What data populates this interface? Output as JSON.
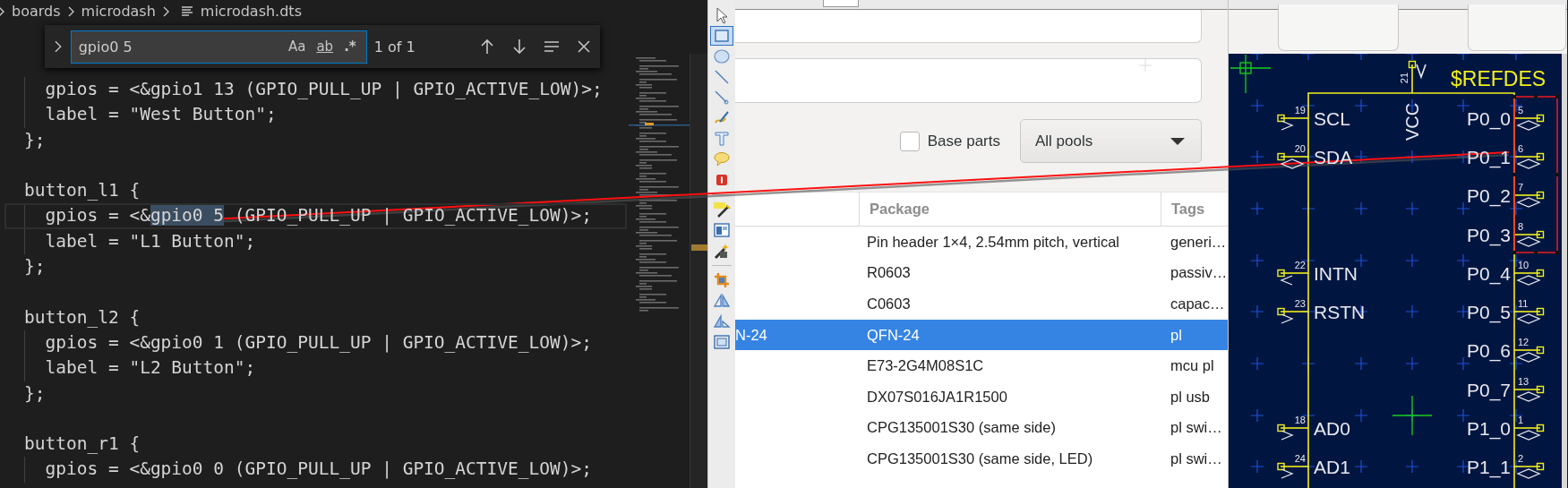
{
  "editor": {
    "breadcrumb": [
      "boards",
      "microdash",
      "microdash.dts"
    ],
    "find": {
      "query": "gpio0 5",
      "options": [
        "Aa",
        "ab",
        ".*"
      ],
      "match_count": "1 of 1"
    },
    "blocks": [
      {
        "lines": [
          {
            "text": "  gpios = <&gpio1 13 (GPIO_PULL_UP | GPIO_ACTIVE_LOW)>;",
            "indented": true,
            "current": false
          },
          {
            "text": "  label = \"West Button\";",
            "indented": true,
            "current": false
          },
          {
            "text": "};",
            "indented": false,
            "current": false
          }
        ]
      },
      {
        "lines": [
          {
            "text": "button_l1 {",
            "indented": false,
            "current": false
          },
          {
            "text": "  gpios = <&",
            "match": "gpio0 5",
            "text_after": " (GPIO_PULL_UP | GPIO_ACTIVE_LOW)>;",
            "indented": true,
            "current": true
          },
          {
            "text": "  label = \"L1 Button\";",
            "indented": true,
            "current": false
          },
          {
            "text": "};",
            "indented": false,
            "current": false
          }
        ]
      },
      {
        "lines": [
          {
            "text": "button_l2 {",
            "indented": false,
            "current": false
          },
          {
            "text": "  gpios = <&gpio0 1 (GPIO_PULL_UP | GPIO_ACTIVE_LOW)>;",
            "indented": true,
            "current": false
          },
          {
            "text": "  label = \"L2 Button\";",
            "indented": true,
            "current": false
          },
          {
            "text": "};",
            "indented": false,
            "current": false
          }
        ]
      },
      {
        "lines": [
          {
            "text": "button_r1 {",
            "indented": false,
            "current": false
          },
          {
            "text": "  gpios = <&gpio0 0 (GPIO_PULL_UP | GPIO_ACTIVE_LOW)>;",
            "indented": true,
            "current": false
          }
        ]
      }
    ]
  },
  "toolbar": {
    "tools": [
      {
        "kind": "pointer",
        "selected": false
      },
      {
        "kind": "rectangle",
        "selected": true
      },
      {
        "kind": "ellipse",
        "selected": false
      },
      {
        "kind": "line",
        "selected": false
      },
      {
        "kind": "arrow",
        "selected": false
      },
      {
        "kind": "draw",
        "selected": false
      },
      {
        "kind": "text",
        "selected": false
      },
      {
        "kind": "callout",
        "selected": false
      },
      {
        "kind": "counter",
        "selected": false
      },
      {
        "kind": "separator"
      },
      {
        "kind": "spell",
        "selected": false
      },
      {
        "kind": "image",
        "selected": false
      },
      {
        "kind": "wand",
        "selected": false
      },
      {
        "kind": "separator"
      },
      {
        "kind": "crop",
        "selected": false
      },
      {
        "kind": "flip_h",
        "selected": false
      },
      {
        "kind": "flip_v",
        "selected": false
      },
      {
        "kind": "frame",
        "selected": false
      }
    ]
  },
  "part_browser": {
    "base_parts": {
      "label": "Base parts",
      "checked": false
    },
    "pool_select": {
      "value": "All pools"
    },
    "table": {
      "columns": [
        "Package",
        "Tags"
      ],
      "rows": [
        {
          "package": "Pin header 1×4, 2.54mm pitch, vertical",
          "tags": "generi…",
          "selected": false
        },
        {
          "package": "R0603",
          "tags": "passiv…",
          "selected": false
        },
        {
          "package": "C0603",
          "tags": "capac…",
          "selected": false
        },
        {
          "column_1": "N-24",
          "package": "QFN-24",
          "tags": "pl",
          "selected": true
        },
        {
          "package": "E73-2G4M08S1C",
          "tags": "mcu pl",
          "selected": false
        },
        {
          "package": "DX07S016JA1R1500",
          "tags": "pl usb",
          "selected": false
        },
        {
          "package": "CPG135001S30 (same side)",
          "tags": "pl swi…",
          "selected": false
        },
        {
          "package": "CPG135001S30 (same side, LED)",
          "tags": "pl swi…",
          "selected": false
        }
      ]
    }
  },
  "schematic": {
    "refdes": "$REFDES",
    "top_pin": {
      "name": "VCC",
      "number": "21",
      "kind": "power"
    },
    "rows": [
      {
        "left": {
          "name": "SCL",
          "number": "19",
          "kind": "input"
        },
        "right": {
          "name": "P0_0",
          "number": "5",
          "kind": "bidirectional",
          "selected": true
        }
      },
      {
        "left": {
          "name": "SDA",
          "number": "20",
          "kind": "bidirectional"
        },
        "right": {
          "name": "P0_1",
          "number": "6",
          "kind": "bidirectional",
          "selected": true
        }
      },
      {
        "right": {
          "name": "P0_2",
          "number": "7",
          "kind": "bidirectional",
          "selected": true
        }
      },
      {
        "right": {
          "name": "P0_3",
          "number": "8",
          "kind": "bidirectional",
          "selected": true
        }
      },
      {
        "left": {
          "name": "INTN",
          "number": "22",
          "kind": "output"
        },
        "right": {
          "name": "P0_4",
          "number": "10",
          "kind": "bidirectional",
          "selected": false
        }
      },
      {
        "left": {
          "name": "RSTN",
          "number": "23",
          "kind": "input"
        },
        "right": {
          "name": "P0_5",
          "number": "11",
          "kind": "bidirectional",
          "selected": false
        }
      },
      {
        "right": {
          "name": "P0_6",
          "number": "12",
          "kind": "bidirectional",
          "selected": false
        }
      },
      {
        "right": {
          "name": "P0_7",
          "number": "13",
          "kind": "bidirectional",
          "selected": false
        }
      },
      {
        "left": {
          "name": "AD0",
          "number": "18",
          "kind": "input"
        },
        "right": {
          "name": "P1_0",
          "number": "1",
          "kind": "bidirectional",
          "selected": false
        }
      },
      {
        "left": {
          "name": "AD1",
          "number": "24",
          "kind": "input"
        },
        "right": {
          "name": "P1_1",
          "number": "2",
          "kind": "bidirectional",
          "selected": false
        }
      }
    ]
  }
}
